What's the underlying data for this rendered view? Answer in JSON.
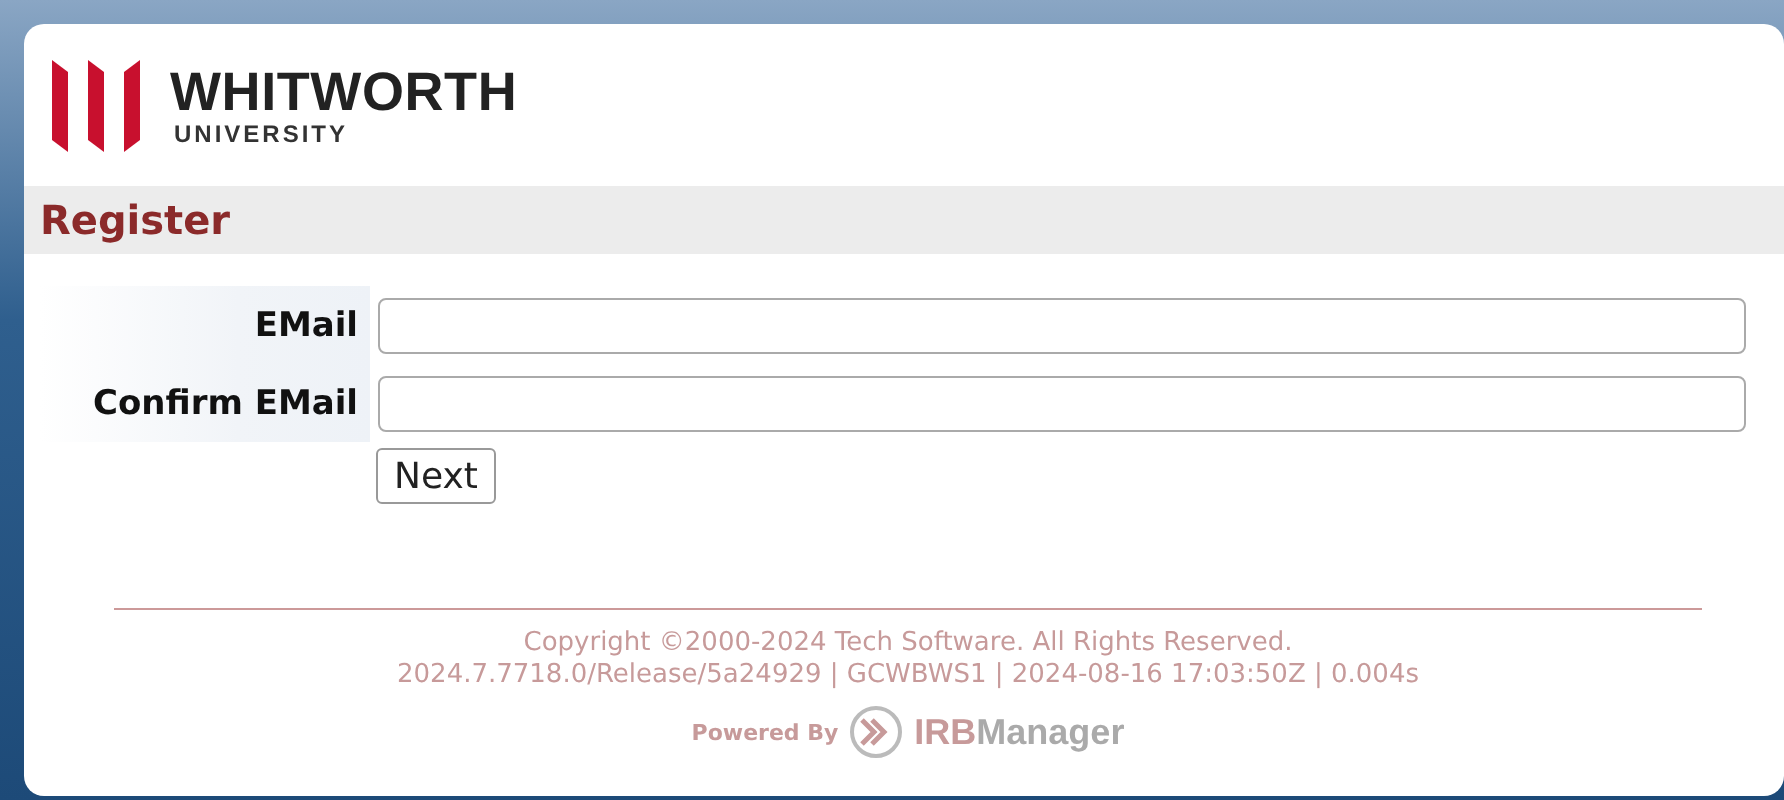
{
  "logo": {
    "name": "WHITWORTH",
    "subtitle": "UNIVERSITY"
  },
  "page_title": "Register",
  "form": {
    "fields": [
      {
        "label": "EMail"
      },
      {
        "label": "Confirm EMail"
      }
    ],
    "button": "Next"
  },
  "footer": {
    "copyright": "Copyright ©2000-2024 Tech Software. All Rights Reserved.",
    "version": "2024.7.7718.0/Release/5a24929 | GCWBWS1 | 2024-08-16 17:03:50Z | 0.004s",
    "powered_by": "Powered By",
    "brand_first": "IRB",
    "brand_second": "Manager"
  }
}
